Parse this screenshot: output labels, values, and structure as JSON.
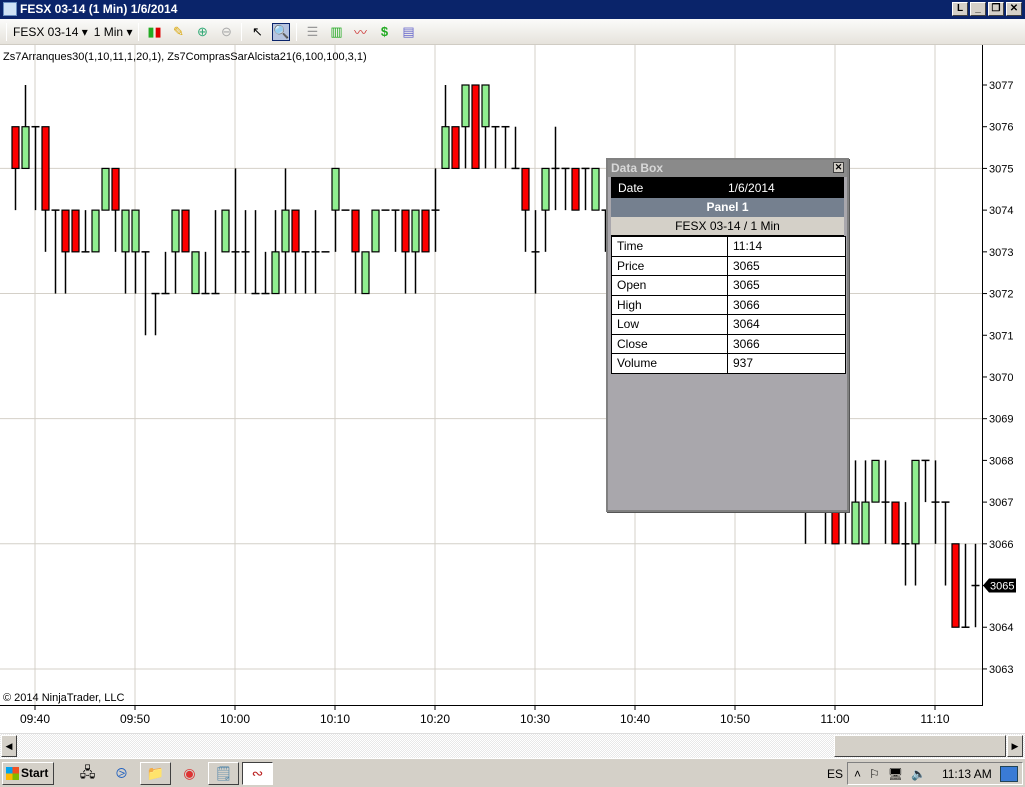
{
  "window": {
    "title": "FESX 03-14 (1 Min)  1/6/2014",
    "buttons": {
      "link": "L",
      "minimize": "_",
      "restore": "❐",
      "close": "✕"
    }
  },
  "toolbar": {
    "instrument": "FESX 03-14",
    "interval": "1 Min",
    "dropdown_arrow": "▾"
  },
  "indicators_label": "Zs7Arranques30(1,10,11,1,20,1), Zs7ComprasSarAlcista21(6,100,100,3,1)",
  "copyright": "© 2014 NinjaTrader, LLC",
  "current_price_label": "3065",
  "data_box": {
    "title": "Data Box",
    "close": "✕",
    "date_label": "Date",
    "date_value": "1/6/2014",
    "panel": "Panel 1",
    "instrument": "FESX 03-14 / 1 Min",
    "rows": [
      {
        "label": "Time",
        "value": "11:14"
      },
      {
        "label": "Price",
        "value": "3065"
      },
      {
        "label": "Open",
        "value": "3065"
      },
      {
        "label": "High",
        "value": "3066"
      },
      {
        "label": "Low",
        "value": "3064"
      },
      {
        "label": "Close",
        "value": "3066"
      },
      {
        "label": "Volume",
        "value": "937"
      }
    ]
  },
  "scrollbar": {
    "left": "◀",
    "right": "▶"
  },
  "taskbar": {
    "start": "Start",
    "lang": "ES",
    "clock": "11:13 AM"
  },
  "colors": {
    "up": "#90ee90",
    "down": "#ff0000",
    "grid": "#d4d0c8",
    "titlebar": "#0a246a"
  },
  "chart_data": {
    "type": "candlestick",
    "title": "FESX 03-14 (1 Min) 1/6/2014",
    "xlabel": "",
    "ylabel": "",
    "ylim": [
      3062.6,
      3078
    ],
    "x_ticks": [
      "09:40",
      "09:50",
      "10:00",
      "10:10",
      "10:20",
      "10:30",
      "10:40",
      "10:50",
      "11:00",
      "11:10"
    ],
    "y_ticks": [
      3077,
      3076,
      3075,
      3074,
      3073,
      3072,
      3071,
      3070,
      3069,
      3068,
      3067,
      3066,
      3065,
      3064,
      3063
    ],
    "bars_columns": [
      "time",
      "open",
      "high",
      "low",
      "close"
    ],
    "bars": [
      [
        "09:38",
        3076,
        3076,
        3074,
        3075
      ],
      [
        "09:39",
        3075,
        3077,
        3075,
        3076
      ],
      [
        "09:40",
        3076,
        3076,
        3074,
        3076
      ],
      [
        "09:41",
        3076,
        3076,
        3073,
        3074
      ],
      [
        "09:42",
        3074,
        3074,
        3072,
        3074
      ],
      [
        "09:43",
        3074,
        3074,
        3072,
        3073
      ],
      [
        "09:44",
        3074,
        3074,
        3073,
        3073
      ],
      [
        "09:45",
        3073,
        3074,
        3073,
        3073
      ],
      [
        "09:46",
        3073,
        3074,
        3073,
        3074
      ],
      [
        "09:47",
        3074,
        3075,
        3074,
        3075
      ],
      [
        "09:48",
        3075,
        3075,
        3073,
        3074
      ],
      [
        "09:49",
        3073,
        3074,
        3072,
        3074
      ],
      [
        "09:50",
        3073,
        3074,
        3072,
        3074
      ],
      [
        "09:51",
        3073,
        3073,
        3071,
        3073
      ],
      [
        "09:52",
        3072,
        3072,
        3071,
        3072
      ],
      [
        "09:53",
        3072,
        3073,
        3072,
        3072
      ],
      [
        "09:54",
        3073,
        3074,
        3072,
        3074
      ],
      [
        "09:55",
        3074,
        3074,
        3073,
        3073
      ],
      [
        "09:56",
        3072,
        3073,
        3072,
        3073
      ],
      [
        "09:57",
        3072,
        3073,
        3072,
        3072
      ],
      [
        "09:58",
        3072,
        3074,
        3072,
        3072
      ],
      [
        "09:59",
        3073,
        3074,
        3073,
        3074
      ],
      [
        "10:00",
        3073,
        3075,
        3072,
        3073
      ],
      [
        "10:01",
        3073,
        3074,
        3072,
        3073
      ],
      [
        "10:02",
        3072,
        3074,
        3072,
        3072
      ],
      [
        "10:03",
        3072,
        3073,
        3072,
        3072
      ],
      [
        "10:04",
        3072,
        3074,
        3072,
        3073
      ],
      [
        "10:05",
        3073,
        3075,
        3072,
        3074
      ],
      [
        "10:06",
        3074,
        3074,
        3072,
        3073
      ],
      [
        "10:07",
        3073,
        3073,
        3072,
        3073
      ],
      [
        "10:08",
        3073,
        3074,
        3072,
        3073
      ],
      [
        "10:09",
        3073,
        3073,
        3073,
        3073
      ],
      [
        "10:10",
        3074,
        3075,
        3073,
        3075
      ],
      [
        "10:11",
        3074,
        3074,
        3074,
        3074
      ],
      [
        "10:12",
        3074,
        3074,
        3072,
        3073
      ],
      [
        "10:13",
        3072,
        3073,
        3072,
        3073
      ],
      [
        "10:14",
        3073,
        3074,
        3073,
        3074
      ],
      [
        "10:15",
        3074,
        3074,
        3074,
        3074
      ],
      [
        "10:16",
        3074,
        3074,
        3073,
        3074
      ],
      [
        "10:17",
        3074,
        3074,
        3072,
        3073
      ],
      [
        "10:18",
        3073,
        3074,
        3072,
        3074
      ],
      [
        "10:19",
        3074,
        3074,
        3073,
        3073
      ],
      [
        "10:20",
        3074,
        3075,
        3073,
        3074
      ],
      [
        "10:21",
        3075,
        3077,
        3075,
        3076
      ],
      [
        "10:22",
        3076,
        3076,
        3075,
        3075
      ],
      [
        "10:23",
        3076,
        3077,
        3075,
        3077
      ],
      [
        "10:24",
        3077,
        3077,
        3075,
        3075
      ],
      [
        "10:25",
        3076,
        3077,
        3075,
        3077
      ],
      [
        "10:26",
        3076,
        3076,
        3075,
        3076
      ],
      [
        "10:27",
        3076,
        3076,
        3075,
        3076
      ],
      [
        "10:28",
        3075,
        3076,
        3075,
        3075
      ],
      [
        "10:29",
        3075,
        3075,
        3073,
        3074
      ],
      [
        "10:30",
        3073,
        3074,
        3072,
        3073
      ],
      [
        "10:31",
        3074,
        3075,
        3073,
        3075
      ],
      [
        "10:32",
        3075,
        3076,
        3074,
        3075
      ],
      [
        "10:33",
        3075,
        3075,
        3074,
        3075
      ],
      [
        "10:34",
        3075,
        3075,
        3074,
        3074
      ],
      [
        "10:35",
        3075,
        3075,
        3074,
        3075
      ],
      [
        "10:36",
        3074,
        3075,
        3074,
        3075
      ],
      [
        "10:37",
        3074,
        3074,
        3073,
        3074
      ],
      [
        "10:38",
        3074,
        3074,
        3073,
        3073
      ],
      [
        "10:57",
        3067,
        3067,
        3066,
        3067
      ],
      [
        "10:59",
        3067,
        3067,
        3066,
        3067
      ],
      [
        "11:00",
        3067,
        3067,
        3066,
        3066
      ],
      [
        "11:01",
        3067,
        3067,
        3066,
        3067
      ],
      [
        "11:02",
        3066,
        3068,
        3066,
        3067
      ],
      [
        "11:03",
        3066,
        3068,
        3066,
        3067
      ],
      [
        "11:04",
        3067,
        3068,
        3067,
        3068
      ],
      [
        "11:05",
        3067,
        3068,
        3066,
        3067
      ],
      [
        "11:06",
        3067,
        3067,
        3066,
        3066
      ],
      [
        "11:07",
        3066,
        3067,
        3065,
        3066
      ],
      [
        "11:08",
        3066,
        3068,
        3065,
        3068
      ],
      [
        "11:09",
        3068,
        3068,
        3067,
        3068
      ],
      [
        "11:10",
        3067,
        3068,
        3066,
        3067
      ],
      [
        "11:11",
        3067,
        3067,
        3065,
        3067
      ],
      [
        "11:12",
        3066,
        3066,
        3064,
        3064
      ],
      [
        "11:13",
        3064,
        3066,
        3064,
        3064
      ],
      [
        "11:14",
        3065,
        3066,
        3064,
        3065
      ]
    ]
  }
}
